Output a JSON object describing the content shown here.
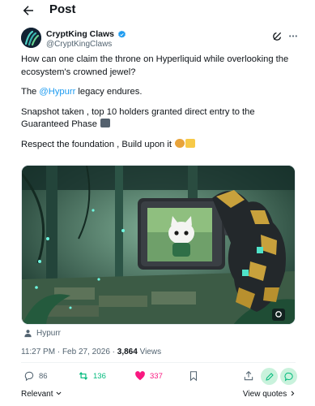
{
  "header": {
    "title": "Post"
  },
  "author": {
    "display_name": "CryptKing Claws",
    "handle": "@CryptKingClaws"
  },
  "tweet": {
    "line1": "How can one claim the throne on Hyperliquid while overlooking the ecosystem's crowned jewel?",
    "line2_pre": "The ",
    "mention": "@Hypurr",
    "line2_post": " legacy endures.",
    "line3": "Snapshot taken , top 10 holders granted direct entry to the Guaranteed Phase",
    "line4": "Respect the foundation , Build upon it"
  },
  "media": {
    "caption": "Hypurr"
  },
  "meta": {
    "timestamp": "11:27 PM · Feb 27, 2026 · ",
    "views_count": "3,864",
    "views_label": " Views"
  },
  "actions": {
    "replies": "86",
    "reposts": "136",
    "likes": "337"
  },
  "footer": {
    "relevant": "Relevant",
    "view_quotes": "View quotes"
  },
  "colors": {
    "accent": "#1d9bf0",
    "repost_green": "#00ba7c",
    "like_pink": "#f91880",
    "muted": "#536471"
  }
}
